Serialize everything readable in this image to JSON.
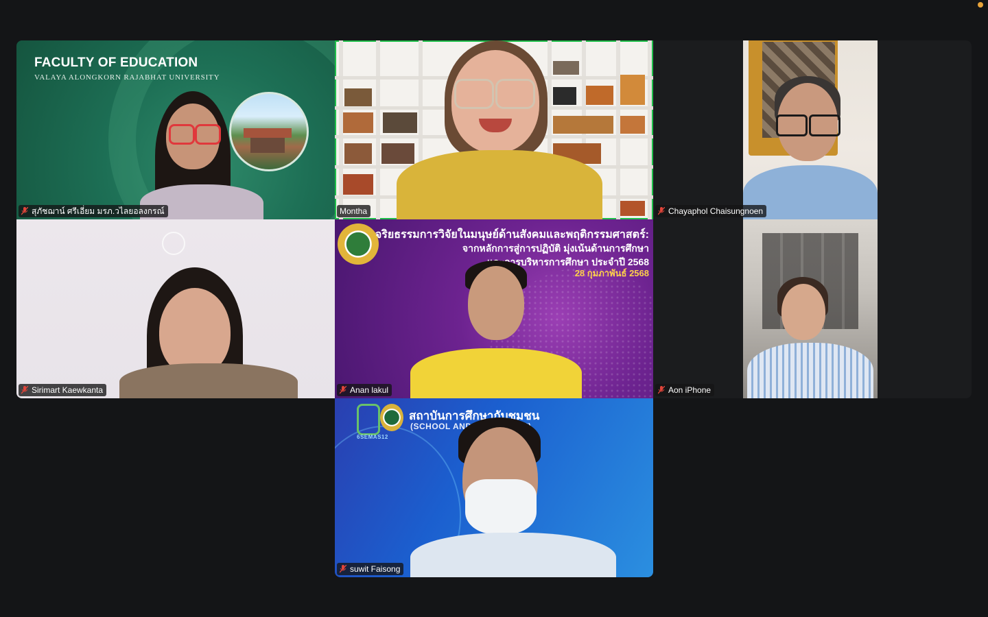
{
  "meeting": {
    "participants": [
      {
        "name": "สุภัชฌาน์  ศรีเอี่ยม มรภ.วไลยอลงกรณ์",
        "muted": true
      },
      {
        "name": "Montha",
        "muted": false,
        "active_speaker": true
      },
      {
        "name": "Chayaphol Chaisungnoen",
        "muted": true
      },
      {
        "name": "Sirimart Kaewkanta",
        "muted": true
      },
      {
        "name": "Anan lakul",
        "muted": true
      },
      {
        "name": "Aon iPhone",
        "muted": true
      },
      {
        "name": "suwit Faisong",
        "muted": true
      }
    ]
  },
  "backgrounds": {
    "faculty": {
      "title": "FACULTY OF EDUCATION",
      "subtitle": "VALAYA ALONGKORN RAJABHAT UNIVERSITY"
    },
    "seminar": {
      "line1": "จริยธรรมการวิจัยในมนุษย์ด้านสังคมและพฤติกรรมศาสตร์:",
      "line2": "จากหลักการสู่การปฏิบัติ มุ่งเน้นด้านการศึกษา",
      "line3": "และการบริหารการศึกษา ประจำปี 2568",
      "line4": "28 กุมภาพันธ์ 2568"
    },
    "school": {
      "title": "สถาบันการศึกษากับชุมชน",
      "subtitle": "(SCHOOL AND COMMUNITY)",
      "code": "6SEMAS12"
    }
  },
  "colors": {
    "active_border": "#1fbf4a",
    "muted_icon": "#e0453a",
    "status_dot": "#e8a33a"
  }
}
